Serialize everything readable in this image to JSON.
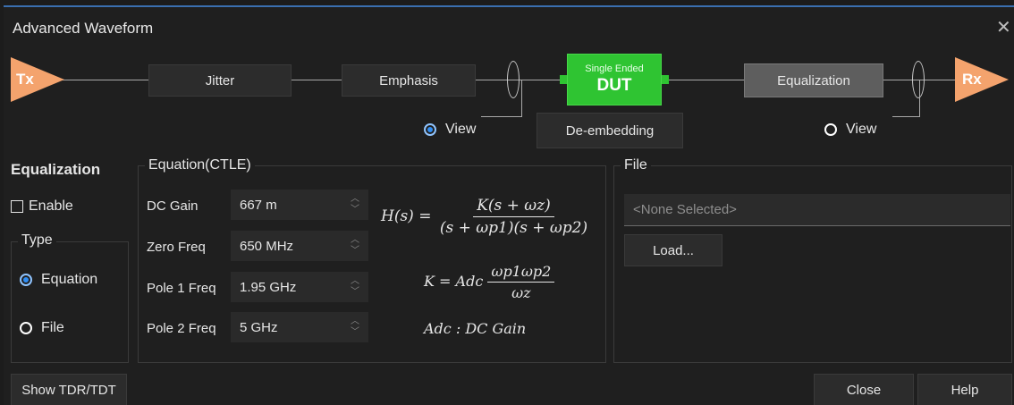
{
  "window": {
    "title": "Advanced Waveform",
    "close_glyph": "✕"
  },
  "chain": {
    "tx_label": "Tx",
    "rx_label": "Rx",
    "jitter_label": "Jitter",
    "emphasis_label": "Emphasis",
    "dut_small": "Single Ended",
    "dut_label": "DUT",
    "equalization_label": "Equalization",
    "deembedding_label": "De-embedding",
    "view_left_label": "View",
    "view_right_label": "View",
    "view_left_selected": true,
    "view_right_selected": false,
    "tx_color": "#f4a36d",
    "dut_color": "#2fc432"
  },
  "equalization": {
    "heading": "Equalization",
    "enable_label": "Enable",
    "enable_checked": false,
    "type_title": "Type",
    "types": [
      {
        "label": "Equation",
        "selected": true
      },
      {
        "label": "File",
        "selected": false
      }
    ]
  },
  "equation": {
    "title": "Equation(CTLE)",
    "params": [
      {
        "label": "DC Gain",
        "value": "667 m"
      },
      {
        "label": "Zero Freq",
        "value": "650 MHz"
      },
      {
        "label": "Pole 1 Freq",
        "value": "1.95 GHz"
      },
      {
        "label": "Pole 2 Freq",
        "value": "5 GHz"
      }
    ],
    "formula": {
      "h_lhs": "H(s) =",
      "h_num": "K(s + ωz)",
      "h_den": "(s + ωp1)(s + ωp2)",
      "k_lhs": "K = Adc",
      "k_num": "ωp1ωp2",
      "k_den": "ωz",
      "adc_text": "Adc : DC Gain"
    }
  },
  "file": {
    "title": "File",
    "placeholder": "<None Selected>",
    "load_label": "Load..."
  },
  "footer": {
    "show_tdr_label": "Show TDR/TDT",
    "close_label": "Close",
    "help_label": "Help"
  }
}
